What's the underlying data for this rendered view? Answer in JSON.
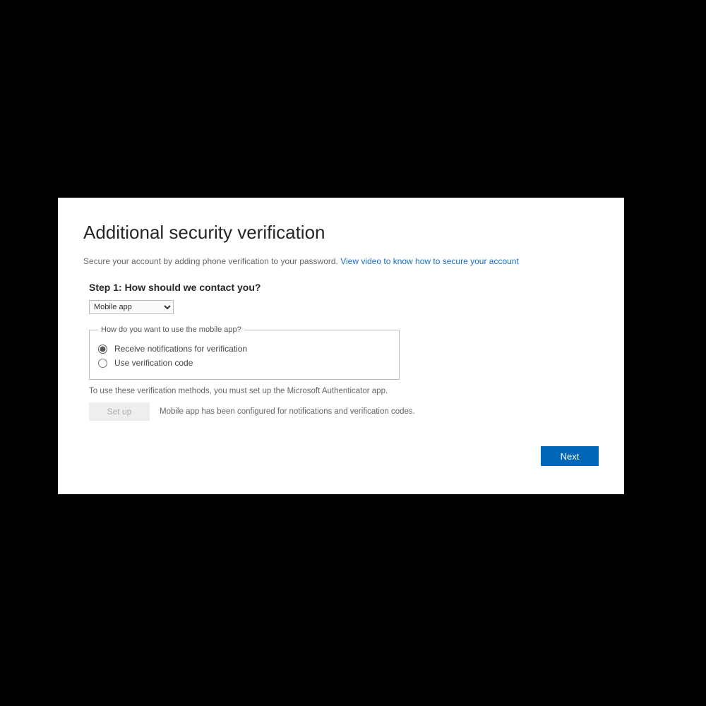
{
  "page": {
    "title": "Additional security verification",
    "intro_text": "Secure your account by adding phone verification to your password. ",
    "intro_link": "View video to know how to secure your account"
  },
  "step": {
    "title": "Step 1: How should we contact you?",
    "select_value": "Mobile app"
  },
  "fieldset": {
    "legend": "How do you want to use the mobile app?",
    "option1": "Receive notifications for verification",
    "option2": "Use verification code"
  },
  "note": "To use these verification methods, you must set up the Microsoft Authenticator app.",
  "setup": {
    "button_label": "Set up",
    "status": "Mobile app has been configured for notifications and verification codes."
  },
  "next_label": "Next"
}
